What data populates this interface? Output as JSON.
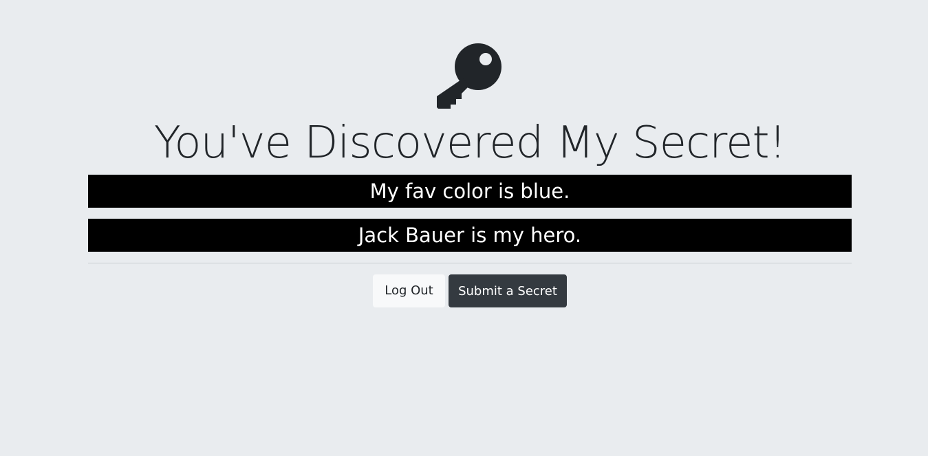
{
  "page": {
    "icon": "key-icon",
    "title": "You've Discovered My Secret!"
  },
  "secrets": [
    "My fav color is blue.",
    "Jack Bauer is my hero."
  ],
  "actions": {
    "logout_label": "Log Out",
    "submit_label": "Submit a Secret"
  },
  "colors": {
    "background": "#e9ecef",
    "secret_bg": "#000000",
    "secret_text": "#ffffff",
    "dark_button": "#343a40",
    "light_button": "#f8f9fa"
  }
}
